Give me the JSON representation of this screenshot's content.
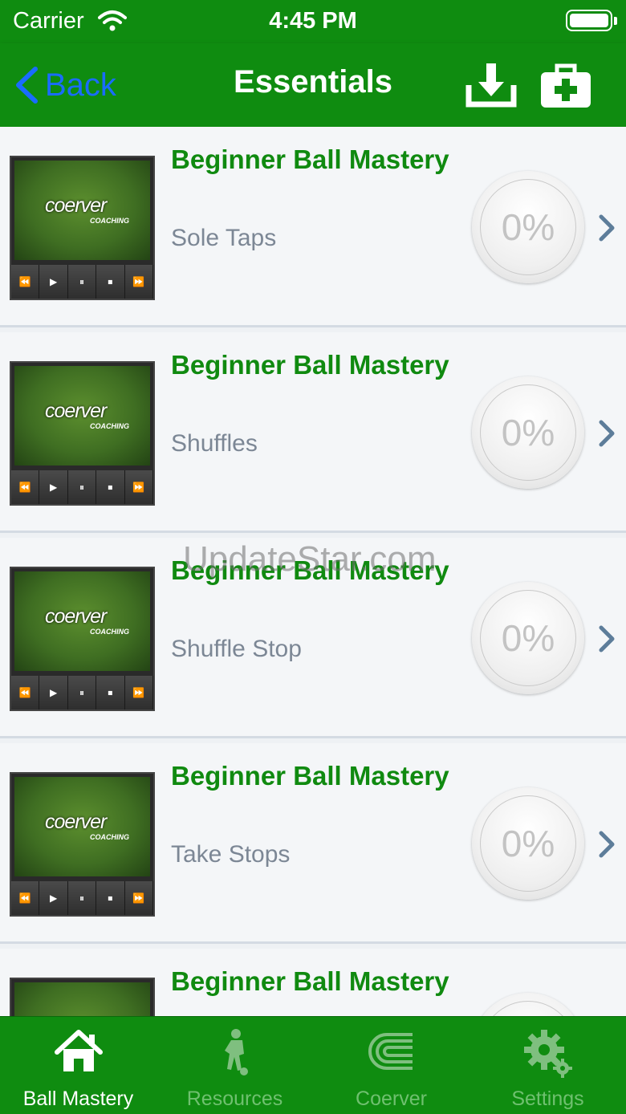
{
  "status_bar": {
    "carrier": "Carrier",
    "time": "4:45 PM"
  },
  "nav": {
    "back_label": "Back",
    "title": "Essentials",
    "download_icon": "download-icon",
    "medkit_icon": "first-aid-kit-icon"
  },
  "items": [
    {
      "title": "Beginner Ball Mastery",
      "subtitle": "Sole Taps",
      "progress": "0%",
      "logo": "coerver",
      "logo_sub": "COACHING"
    },
    {
      "title": "Beginner Ball Mastery",
      "subtitle": "Shuffles",
      "progress": "0%",
      "logo": "coerver",
      "logo_sub": "COACHING"
    },
    {
      "title": "Beginner Ball Mastery",
      "subtitle": "Shuffle Stop",
      "progress": "0%",
      "logo": "coerver",
      "logo_sub": "COACHING"
    },
    {
      "title": "Beginner Ball Mastery",
      "subtitle": "Take Stops",
      "progress": "0%",
      "logo": "coerver",
      "logo_sub": "COACHING"
    },
    {
      "title": "Beginner Ball Mastery",
      "subtitle": "",
      "progress": "",
      "logo": "",
      "logo_sub": ""
    }
  ],
  "player_controls": [
    "⏪",
    "▶",
    "⏸",
    "⏹",
    "⏩"
  ],
  "watermark": "UpdateStar.com",
  "tabs": [
    {
      "label": "Ball Mastery",
      "icon": "home-icon",
      "active": true
    },
    {
      "label": "Resources",
      "icon": "player-icon",
      "active": false
    },
    {
      "label": "Coerver",
      "icon": "coerver-logo-icon",
      "active": false
    },
    {
      "label": "Settings",
      "icon": "gear-icon",
      "active": false
    }
  ],
  "colors": {
    "brand_green": "#0f8c10",
    "title_green": "#108a10",
    "back_blue": "#1a6cff"
  }
}
